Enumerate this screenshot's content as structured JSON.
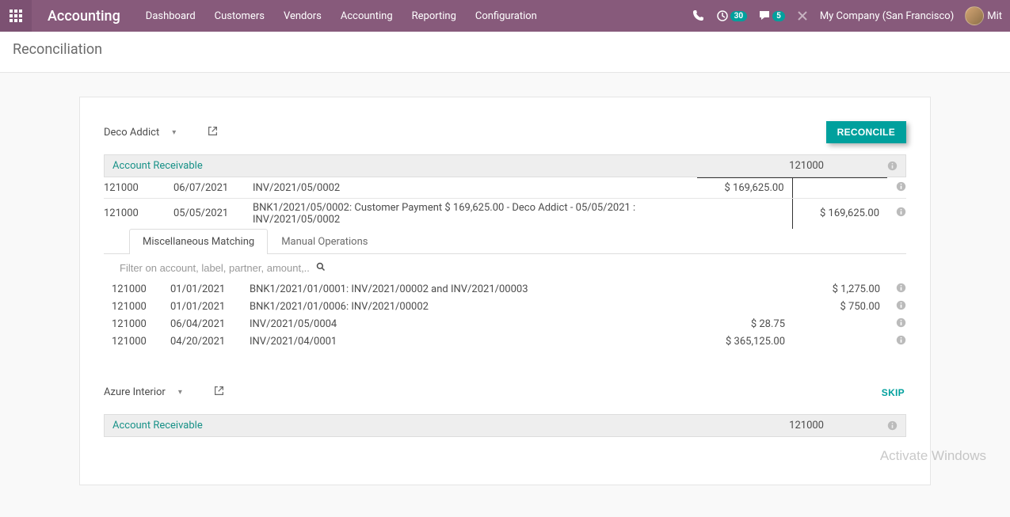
{
  "nav": {
    "brand": "Accounting",
    "items": [
      "Dashboard",
      "Customers",
      "Vendors",
      "Accounting",
      "Reporting",
      "Configuration"
    ],
    "timer_badge": "30",
    "msg_badge": "5",
    "company": "My Company (San Francisco)",
    "user_short": "Mit"
  },
  "breadcrumb": "Reconciliation",
  "blocks": [
    {
      "partner": "Deco Addict",
      "action": "RECONCILE",
      "account_title": "Account Receivable",
      "account_code": "121000",
      "lines": [
        {
          "code": "121000",
          "date": "06/07/2021",
          "desc": "INV/2021/05/0002",
          "debit": "$ 169,625.00",
          "credit": ""
        },
        {
          "code": "121000",
          "date": "05/05/2021",
          "desc": "BNK1/2021/05/0002: Customer Payment $ 169,625.00 - Deco Addict - 05/05/2021 : INV/2021/05/0002",
          "debit": "",
          "credit": "$ 169,625.00"
        }
      ],
      "tabs": [
        "Miscellaneous Matching",
        "Manual Operations"
      ],
      "active_tab": 0,
      "filter_placeholder": "Filter on account, label, partner, amount,..",
      "matches": [
        {
          "code": "121000",
          "date": "01/01/2021",
          "desc": "BNK1/2021/01/0001: INV/2021/00002 and INV/2021/00003",
          "debit": "",
          "credit": "$ 1,275.00"
        },
        {
          "code": "121000",
          "date": "01/01/2021",
          "desc": "BNK1/2021/01/0006: INV/2021/00002",
          "debit": "",
          "credit": "$ 750.00"
        },
        {
          "code": "121000",
          "date": "06/04/2021",
          "desc": "INV/2021/05/0004",
          "debit": "$ 28.75",
          "credit": ""
        },
        {
          "code": "121000",
          "date": "04/20/2021",
          "desc": "INV/2021/04/0001",
          "debit": "$ 365,125.00",
          "credit": ""
        }
      ]
    },
    {
      "partner": "Azure Interior",
      "action": "SKIP",
      "account_title": "Account Receivable",
      "account_code": "121000"
    }
  ],
  "watermark": "Activate Windows"
}
